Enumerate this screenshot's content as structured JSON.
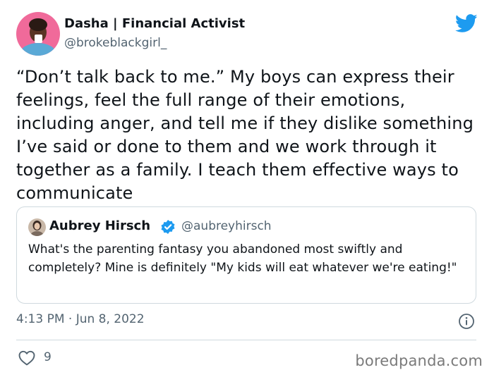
{
  "author": {
    "name": "Dasha | Financial Activist",
    "handle": "@brokeblackgirl_"
  },
  "tweet": {
    "text": "“Don’t talk back to me.” My boys can express their feelings, feel the full range of their emotions, including anger, and tell me if they dislike something I’ve said or done to them and we work through it together as a family. I teach them effective ways to communicate"
  },
  "quoted_tweet": {
    "name": "Aubrey Hirsch",
    "handle": "@aubreyhirsch",
    "text": "What's the parenting fantasy you abandoned most swiftly and completely? Mine is definitely \"My kids will eat whatever we're eating!\""
  },
  "meta": {
    "timestamp": "4:13 PM · Jun 8, 2022",
    "like_count": "9"
  },
  "watermark": "boredpanda.com",
  "colors": {
    "brand_blue": "#1d9bf0",
    "secondary_text": "#536471",
    "border": "#cfd9de",
    "avatar_pink": "#f06a9a"
  },
  "icons": {
    "brand": "bird-icon",
    "verified": "verified-badge-icon",
    "info": "info-icon",
    "like": "heart-icon"
  }
}
